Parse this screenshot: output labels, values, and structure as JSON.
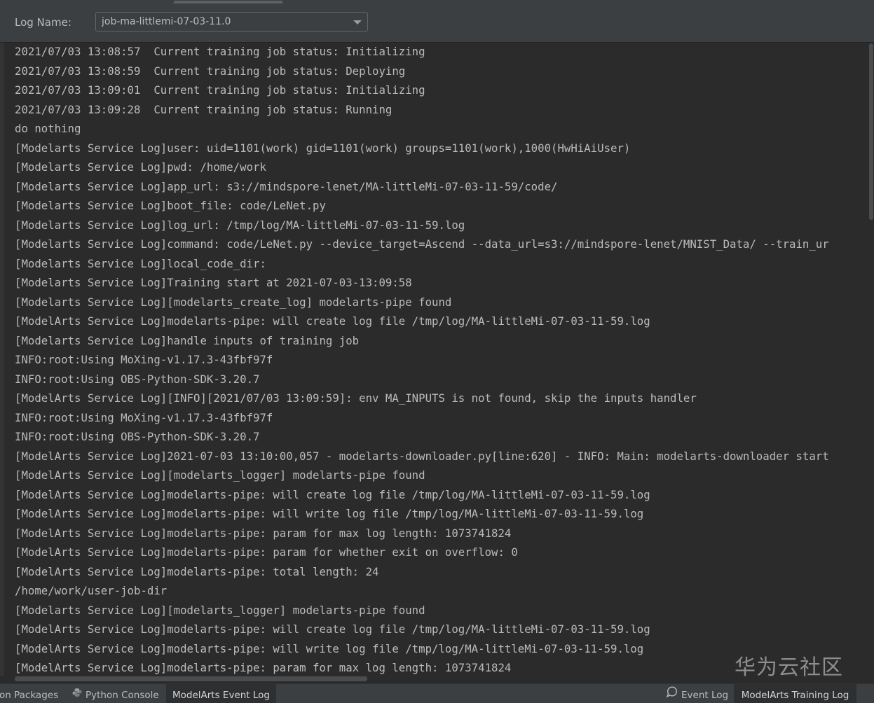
{
  "header": {
    "log_name_label": "Log Name:",
    "log_name_value": "job-ma-littlemi-07-03-11.0"
  },
  "log_lines": [
    "2021/07/03 13:08:57  Current training job status: Initializing",
    "2021/07/03 13:08:59  Current training job status: Deploying",
    "2021/07/03 13:09:01  Current training job status: Initializing",
    "2021/07/03 13:09:28  Current training job status: Running",
    "do nothing",
    "[Modelarts Service Log]user: uid=1101(work) gid=1101(work) groups=1101(work),1000(HwHiAiUser)",
    "[Modelarts Service Log]pwd: /home/work",
    "[Modelarts Service Log]app_url: s3://mindspore-lenet/MA-littleMi-07-03-11-59/code/",
    "[Modelarts Service Log]boot_file: code/LeNet.py",
    "[Modelarts Service Log]log_url: /tmp/log/MA-littleMi-07-03-11-59.log",
    "[Modelarts Service Log]command: code/LeNet.py --device_target=Ascend --data_url=s3://mindspore-lenet/MNIST_Data/ --train_ur",
    "[Modelarts Service Log]local_code_dir:",
    "[Modelarts Service Log]Training start at 2021-07-03-13:09:58",
    "[Modelarts Service Log][modelarts_create_log] modelarts-pipe found",
    "[ModelArts Service Log]modelarts-pipe: will create log file /tmp/log/MA-littleMi-07-03-11-59.log",
    "[Modelarts Service Log]handle inputs of training job",
    "INFO:root:Using MoXing-v1.17.3-43fbf97f",
    "INFO:root:Using OBS-Python-SDK-3.20.7",
    "[ModelArts Service Log][INFO][2021/07/03 13:09:59]: env MA_INPUTS is not found, skip the inputs handler",
    "INFO:root:Using MoXing-v1.17.3-43fbf97f",
    "INFO:root:Using OBS-Python-SDK-3.20.7",
    "[ModelArts Service Log]2021-07-03 13:10:00,057 - modelarts-downloader.py[line:620] - INFO: Main: modelarts-downloader start",
    "[ModelArts Service Log][modelarts_logger] modelarts-pipe found",
    "[ModelArts Service Log]modelarts-pipe: will create log file /tmp/log/MA-littleMi-07-03-11-59.log",
    "[ModelArts Service Log]modelarts-pipe: will write log file /tmp/log/MA-littleMi-07-03-11-59.log",
    "[ModelArts Service Log]modelarts-pipe: param for max log length: 1073741824",
    "[ModelArts Service Log]modelarts-pipe: param for whether exit on overflow: 0",
    "[ModelArts Service Log]modelarts-pipe: total length: 24",
    "/home/work/user-job-dir",
    "[Modelarts Service Log][modelarts_logger] modelarts-pipe found",
    "[ModelArts Service Log]modelarts-pipe: will create log file /tmp/log/MA-littleMi-07-03-11-59.log",
    "[ModelArts Service Log]modelarts-pipe: will write log file /tmp/log/MA-littleMi-07-03-11-59.log",
    "[ModelArts Service Log]modelarts-pipe: param for max log length: 1073741824"
  ],
  "bottom_tabs": {
    "python_packages": "on Packages",
    "python_console": "Python Console",
    "modelarts_event_log": "ModelArts Event Log",
    "event_log": "Event Log",
    "modelarts_training_log": "ModelArts Training Log"
  },
  "watermark": "华为云社区",
  "colors": {
    "background": "#2b2b2b",
    "panel": "#3c3f41",
    "text": "#bbbbbb",
    "active_tab": "#2d2f30"
  },
  "icons": {
    "python_console": "python-logo-icon",
    "event_log": "speech-bubble-icon",
    "dropdown": "chevron-down-icon"
  }
}
